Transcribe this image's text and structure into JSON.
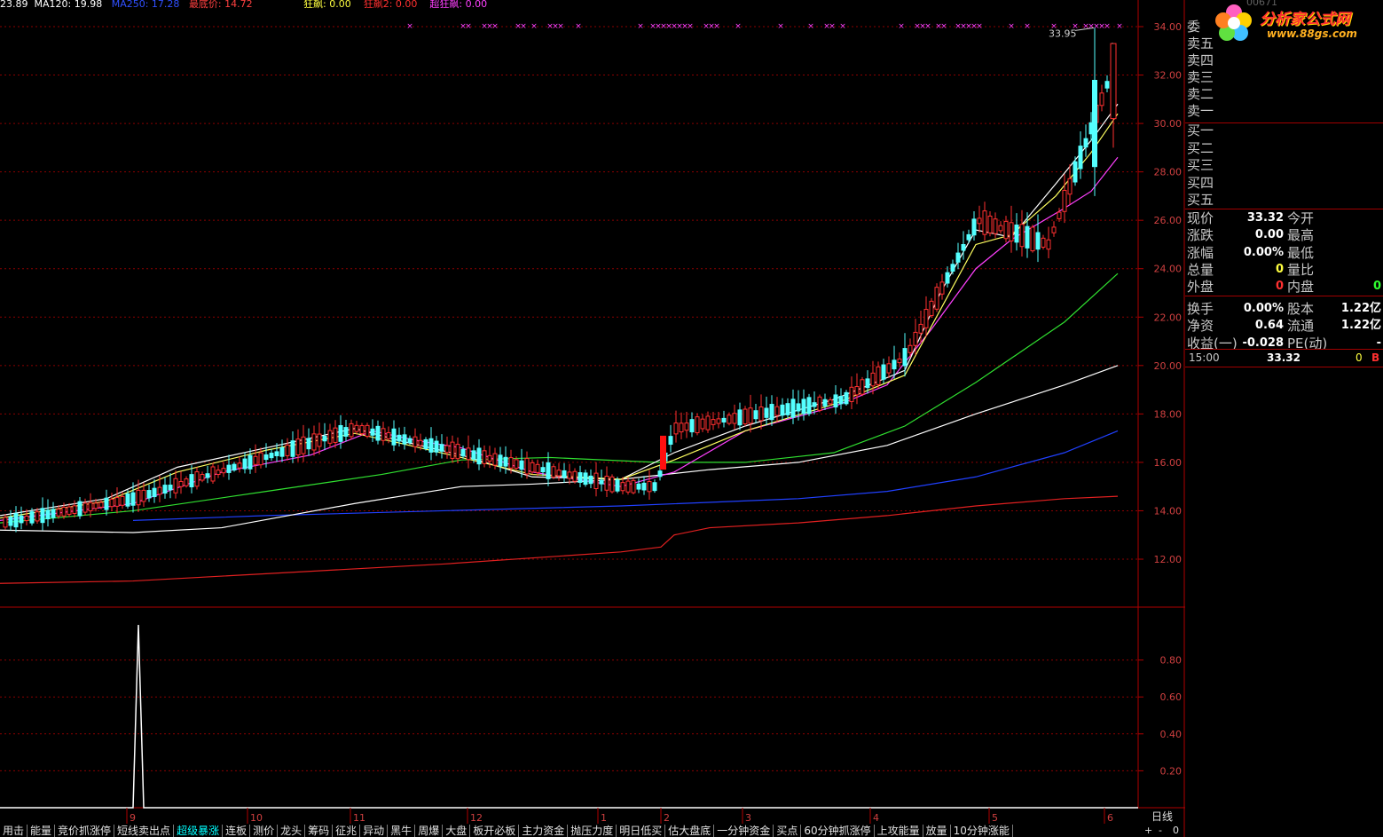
{
  "header": {
    "ma_items": [
      {
        "text": "23.89",
        "color": "#ffffff"
      },
      {
        "text": "MA120: 19.98",
        "color": "#ffffff"
      },
      {
        "text": "MA250: 17.28",
        "color": "#3050ff"
      },
      {
        "text": "最底价: 14.72",
        "color": "#ff4040"
      }
    ],
    "signal_items": [
      {
        "text": "狂飙: 0.00",
        "color": "#ffff40"
      },
      {
        "text": "狂飙2: 0.00",
        "color": "#ff3030"
      },
      {
        "text": "超狂飙: 0.00",
        "color": "#ff40ff"
      }
    ],
    "stock_code_partial": "00671"
  },
  "logo": {
    "title": "分析家公式网",
    "url": "www.88gs.com"
  },
  "axis": {
    "price_ticks": [
      "34.00",
      "32.00",
      "30.00",
      "28.00",
      "26.00",
      "24.00",
      "22.00",
      "20.00",
      "18.00",
      "16.00",
      "14.00",
      "12.00"
    ],
    "indicator_ticks": [
      "0.80",
      "0.60",
      "0.40",
      "0.20"
    ],
    "months": [
      "9",
      "10",
      "11",
      "12",
      "1",
      "2",
      "3",
      "4",
      "5",
      "6"
    ],
    "high_label": "33.95",
    "period": "日线"
  },
  "quote_panel": {
    "ask_labels": [
      "委",
      "卖五",
      "卖四",
      "卖三",
      "卖二",
      "卖一"
    ],
    "bid_labels": [
      "买一",
      "买二",
      "买三",
      "买四",
      "买五"
    ],
    "rows": [
      {
        "l1": "现价",
        "v1": "33.32",
        "c1": "#ffffff",
        "l2": "今开",
        "v2": ""
      },
      {
        "l1": "涨跌",
        "v1": "0.00",
        "c1": "#ffffff",
        "l2": "最高",
        "v2": ""
      },
      {
        "l1": "涨幅",
        "v1": "0.00%",
        "c1": "#ffffff",
        "l2": "最低",
        "v2": ""
      },
      {
        "l1": "总量",
        "v1": "0",
        "c1": "#ffff40",
        "l2": "量比",
        "v2": ""
      },
      {
        "l1": "外盘",
        "v1": "0",
        "c1": "#ff3030",
        "l2": "内盘",
        "v2": "0",
        "c2": "#30ff30"
      },
      {
        "l1": "换手",
        "v1": "0.00%",
        "c1": "#ffffff",
        "l2": "股本",
        "v2": "1.22亿",
        "c2": "#ffffff"
      },
      {
        "l1": "净资",
        "v1": "0.64",
        "c1": "#ffffff",
        "l2": "流通",
        "v2": "1.22亿",
        "c2": "#ffffff"
      },
      {
        "l1": "收益(一)",
        "v1": "-0.028",
        "c1": "#ffffff",
        "l2": "PE(动)",
        "v2": "-",
        "c2": "#ffffff"
      }
    ],
    "tick": {
      "time": "15:00",
      "price": "33.32",
      "vol": "0",
      "flag": "B"
    }
  },
  "tabs": [
    "用击",
    "能量",
    "竞价抓涨停",
    "短线卖出点",
    "超级暴涨",
    "连板",
    "测价",
    "龙头",
    "筹码",
    "征兆",
    "异动",
    "黑牛",
    "周爆",
    "大盘",
    "板开必板",
    "主力资金",
    "抛压力度",
    "明日低买",
    "估大盘底",
    "一分钟资金",
    "买点",
    "60分钟抓涨停",
    "上攻能量",
    "放量",
    "10分钟涨能"
  ],
  "active_tab": "超级暴涨",
  "controls": [
    "+",
    "-",
    "0"
  ],
  "colors": {
    "up": "#ff3030",
    "down": "#54ffff",
    "grid": "#8b0000",
    "ma5": "#ffffff",
    "ma10": "#ffff60",
    "ma20": "#ff40ff",
    "ma60": "#30e030",
    "ma120": "#ffffff",
    "ma250": "#2040ff",
    "bottom": "#e02020"
  }
}
